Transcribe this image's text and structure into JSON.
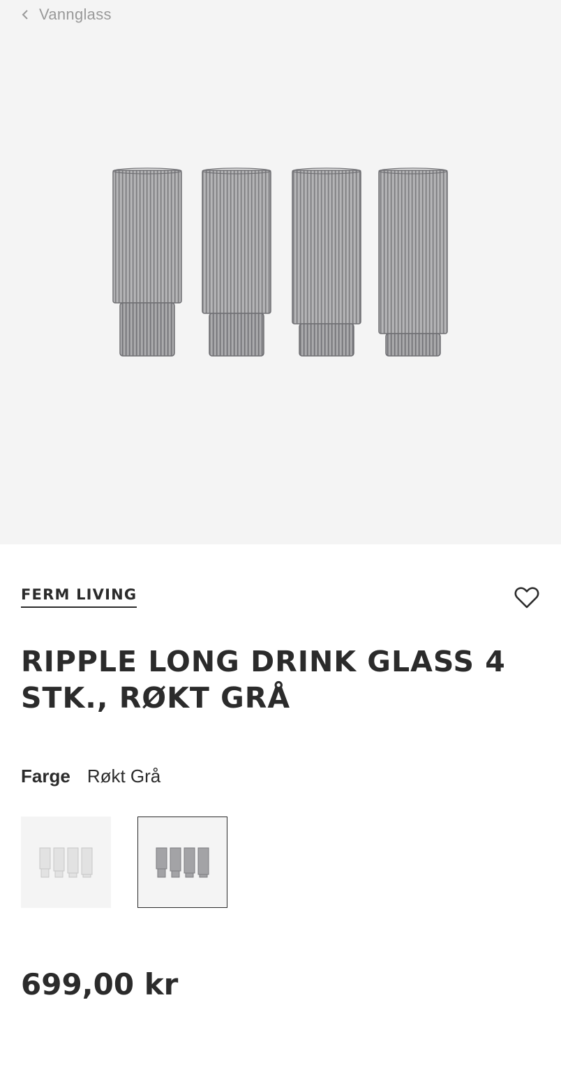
{
  "nav": {
    "back_label": "Vannglass",
    "back_icon": "chevron-left-icon"
  },
  "product": {
    "brand": "FERM LIVING",
    "title": "RIPPLE LONG DRINK GLASS 4 STK., RØKT GRÅ",
    "price": "699,00 kr",
    "wishlist_icon": "heart-outline-icon"
  },
  "variant": {
    "label": "Farge",
    "selected_value": "Røkt Grå",
    "options": [
      {
        "name": "clear",
        "glass_color": "#d9d9d9",
        "selected": false
      },
      {
        "name": "smoked-grey",
        "glass_color": "#8c8c8c",
        "selected": true
      }
    ]
  },
  "colors": {
    "text": "#2b2b2b",
    "muted": "#999999",
    "hero_bg": "#f4f4f4"
  }
}
